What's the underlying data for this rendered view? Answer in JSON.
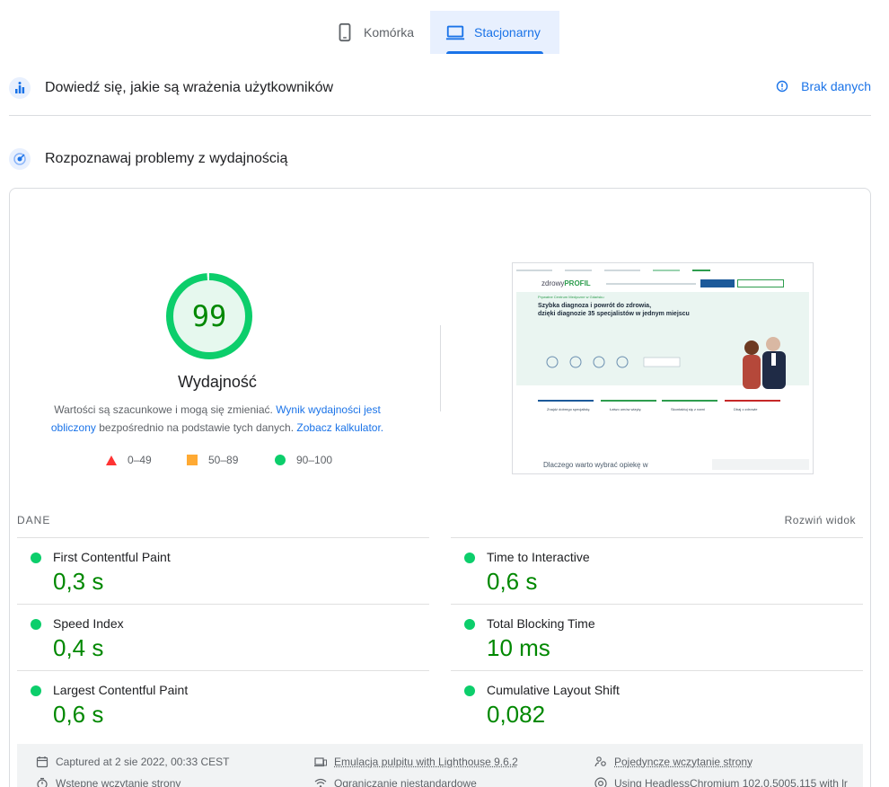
{
  "tabs": {
    "mobile": {
      "label": "Komórka",
      "icon": "phone-icon",
      "selected": false
    },
    "desktop": {
      "label": "Stacjonarny",
      "icon": "laptop-icon",
      "selected": true
    }
  },
  "field_data": {
    "title": "Dowiedź się, jakie są wrażenia użytkowników",
    "status": "Brak danych"
  },
  "lab_data": {
    "title": "Rozpoznawaj problemy z wydajnością"
  },
  "gauge": {
    "score": "99",
    "score_fraction": 0.99,
    "label": "Wydajność",
    "note_text_1": "Wartości są szacunkowe i mogą się zmieniać.",
    "note_link_1": "Wynik wydajności jest obliczony",
    "note_text_2": "bezpośrednio na podstawie tych danych.",
    "note_link_2": "Zobacz kalkulator."
  },
  "legend": {
    "fail": "0–49",
    "average": "50–89",
    "pass": "90–100"
  },
  "screenshot": {
    "logo_prefix": "zdrowy",
    "logo_suffix": "PROFIL",
    "kicker": "Prywatne Centrum Medyczne w Gdańsku",
    "headline_1": "Szybka diagnoza i powrót do zdrowia,",
    "headline_2": "dzięki diagnozie 35 specjalistów w jednym miejscu",
    "cards": [
      "Znajdź dobrego specjalistę",
      "Łatwo umów wizytę",
      "Skontaktuj się z nami",
      "Dbaj o zdrowie"
    ],
    "footer": "Dlaczego warto wybrać opiekę w"
  },
  "metrics": {
    "section_label": "DANE",
    "expand_label": "Rozwiń widok",
    "items": [
      {
        "name": "First Contentful Paint",
        "value": "0,3 s"
      },
      {
        "name": "Time to Interactive",
        "value": "0,6 s"
      },
      {
        "name": "Speed Index",
        "value": "0,4 s"
      },
      {
        "name": "Total Blocking Time",
        "value": "10 ms"
      },
      {
        "name": "Largest Contentful Paint",
        "value": "0,6 s"
      },
      {
        "name": "Cumulative Layout Shift",
        "value": "0,082"
      }
    ],
    "status_color": "#0cce6b",
    "value_color": "#008800"
  },
  "runtime": {
    "captured": "Captured at 2 sie 2022, 00:33 CEST",
    "emulation": "Emulacja pulpitu with Lighthouse 9.6.2",
    "load": "Pojedyncze wczytanie strony",
    "initial_load": "Wstępne wczytanie strony",
    "throttling": "Ograniczanie niestandardowe",
    "browser": "Using HeadlessChromium 102.0.5005.115 with lr"
  },
  "colors": {
    "accent": "#1a73e8",
    "pass": "#0cce6b",
    "average": "#ffaa33",
    "fail": "#ff3333"
  }
}
